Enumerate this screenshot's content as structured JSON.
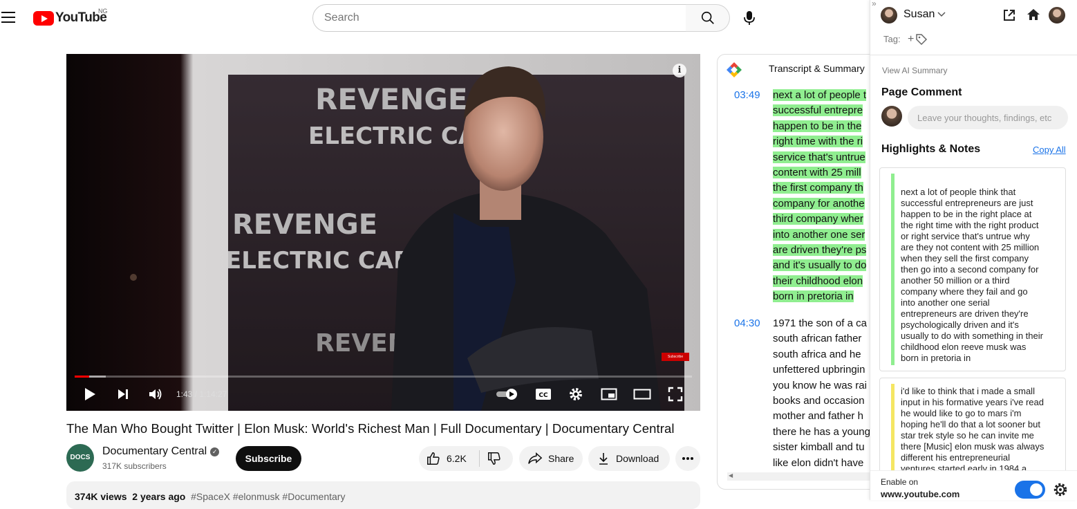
{
  "header": {
    "logo_text": "YouTube",
    "country_code": "NG",
    "search_placeholder": "Search"
  },
  "player": {
    "time": "1:43 / 1:14:27",
    "progress_fraction": 0.023,
    "buffered_fraction": 0.05,
    "watermark": "Subscribe",
    "poster_text_1": "REVENGE",
    "poster_text_2": "ELECTRIC CAR"
  },
  "video": {
    "title": "The Man Who Bought Twitter | Elon Musk: World's Richest Man | Full Documentary | Documentary Central",
    "channel_name": "Documentary Central",
    "channel_avatar_text": "DOCS",
    "subscribers": "317K subscribers",
    "subscribe_label": "Subscribe",
    "likes": "6.2K",
    "share_label": "Share",
    "download_label": "Download",
    "views": "374K views",
    "age": "2 years ago",
    "tags": "#SpaceX #elonmusk #Documentary"
  },
  "transcript": {
    "heading": "Transcript & Summary",
    "segments": [
      {
        "time": "03:49",
        "lines": [
          "next a lot of people t",
          "successful entrepre",
          "happen to be in the",
          "right time with the ri",
          "service that's untrue",
          "content with 25 mill",
          "the first company th",
          "company for anothe",
          "third company wher",
          "into another one ser",
          "are driven they're ps",
          "and it's usually to do",
          "their childhood elon",
          "born in pretoria in"
        ]
      },
      {
        "time": "04:30",
        "lines": [
          "1971 the son of a ca",
          "south african father",
          "south africa and he",
          "unfettered upbringin",
          "you know he was rai",
          "books and occasion",
          "mother and father h",
          "there he has a young",
          "sister kimball and tu",
          "like elon didn't have"
        ]
      }
    ]
  },
  "extension": {
    "user_name": "Susan",
    "tag_label": "Tag:",
    "view_summary": "View AI Summary",
    "page_comment_heading": "Page Comment",
    "comment_placeholder": "Leave your thoughts, findings, etc",
    "highlights_heading": "Highlights & Notes",
    "copy_all": "Copy All",
    "notes": [
      {
        "color": "#90ee90",
        "lines": [
          "next a lot of people think that",
          "successful entrepreneurs are just",
          "happen to be in the right place at",
          "the right time with the right product",
          "or right service that's untrue why",
          "are they not content with 25 million",
          "when they sell the first company",
          "then go into a second company for",
          "another 50 million or a third",
          "company where they fail and go",
          "into another one serial",
          "entrepreneurs are driven they're",
          "psychologically driven and it's",
          "usually to do with something in their",
          "childhood elon reeve musk was",
          "born in pretoria in"
        ]
      },
      {
        "color": "#f5e663",
        "lines": [
          "i'd like to think that i made a small",
          "input in his formative years i've read",
          "he would like to go to mars i'm",
          "hoping he'll do that a lot sooner but",
          "star trek style so he can invite me",
          "there [Music] elon musk was always",
          "different his entrepreneurial",
          "ventures started early in 1984 a"
        ]
      }
    ],
    "enable_label": "Enable on",
    "domain": "www.youtube.com"
  }
}
